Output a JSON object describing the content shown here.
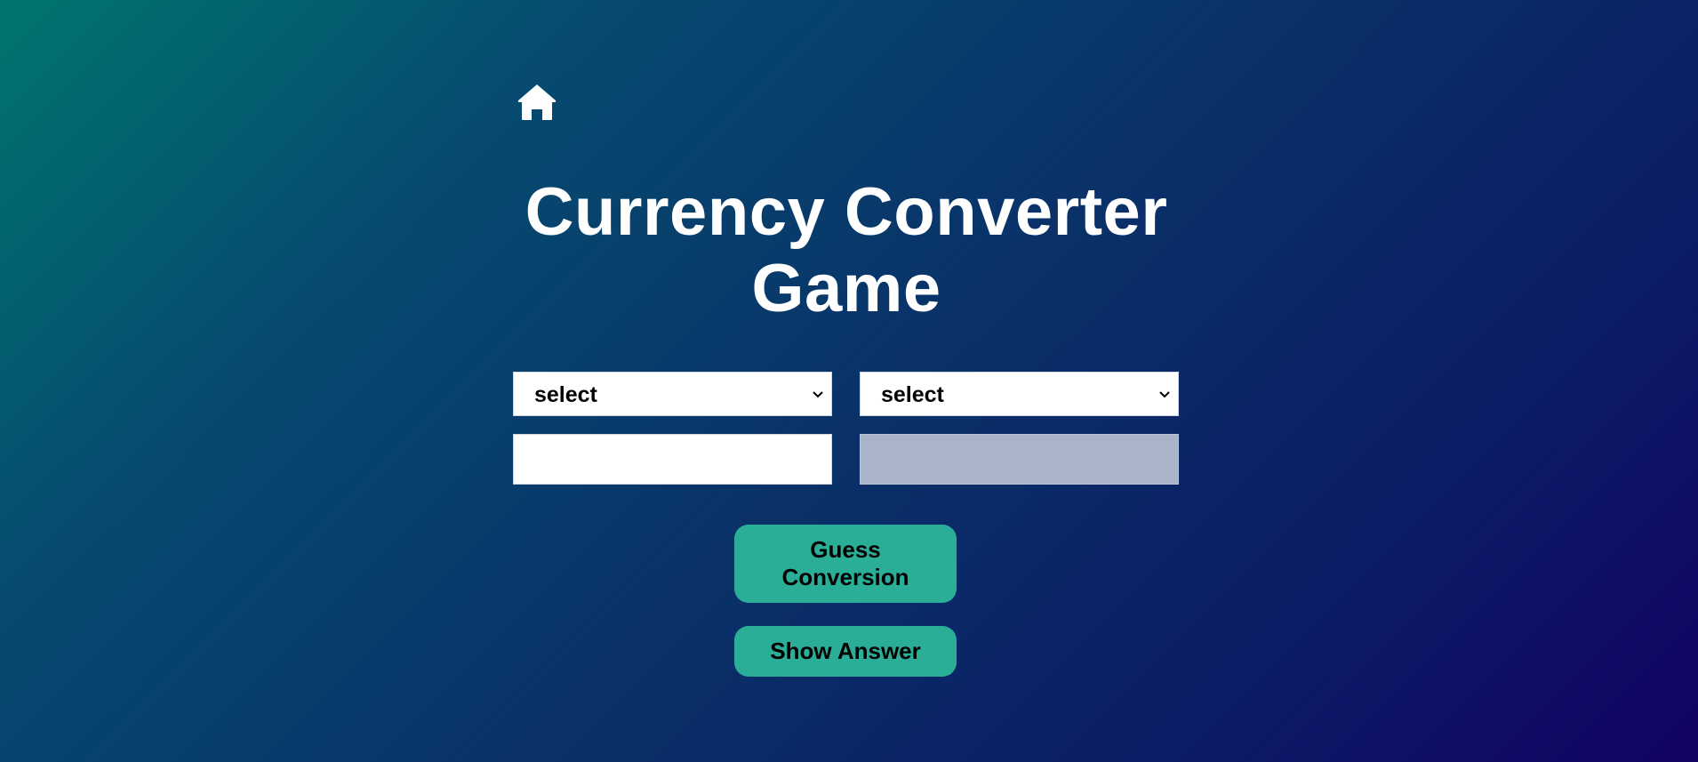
{
  "page": {
    "title_line1": "Currency Converter",
    "title_line2": "Game"
  },
  "nav": {
    "home_icon": "home-icon"
  },
  "from_currency": {
    "selected": "select"
  },
  "to_currency": {
    "selected": "select"
  },
  "amount_input": {
    "value": "",
    "placeholder": ""
  },
  "result_input": {
    "value": "",
    "placeholder": ""
  },
  "buttons": {
    "guess_label": "Guess Conversion",
    "show_answer_label": "Show Answer"
  },
  "colors": {
    "accent": "#2bae97",
    "gradient_start": "#00756f",
    "gradient_end": "#120262",
    "disabled_field": "#a9b4c8"
  }
}
